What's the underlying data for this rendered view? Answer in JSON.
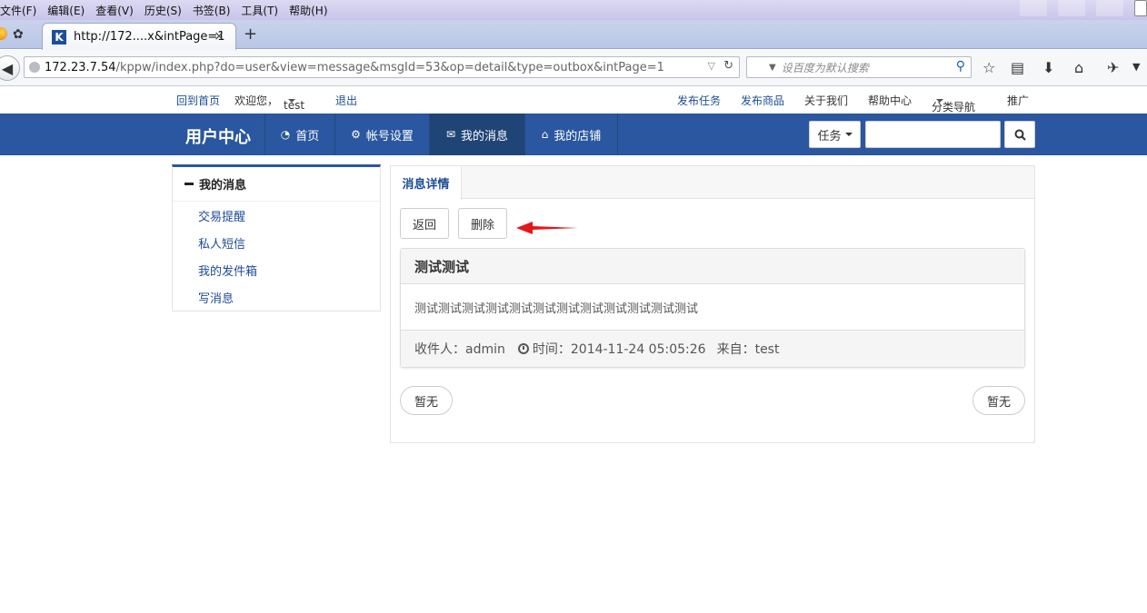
{
  "browser": {
    "menu": [
      "文件(F)",
      "编辑(E)",
      "查看(V)",
      "历史(S)",
      "书签(B)",
      "工具(T)",
      "帮助(H)"
    ],
    "tab_favicon": "K",
    "tab_title": "http://172....x&intPage=1",
    "tab_close": "×",
    "new_tab": "+",
    "url_host": "172.23.7.54",
    "url_path": "/kppw/index.php?do=user&view=message&msgId=53&op=detail&type=outbox&intPage=1",
    "search_placeholder": "设百度为默认搜索"
  },
  "site_top": {
    "home_link": "回到首页",
    "welcome": "欢迎您，",
    "username": "test",
    "logout": "退出",
    "right_links": [
      "发布任务",
      "发布商品",
      "关于我们",
      "帮助中心",
      "分类导航",
      "推广"
    ]
  },
  "header": {
    "brand": "用户中心",
    "nav": [
      "首页",
      "帐号设置",
      "我的消息",
      "我的店铺"
    ],
    "task_dropdown": "任务"
  },
  "sidebar": {
    "title": "我的消息",
    "items": [
      "交易提醒",
      "私人短信",
      "我的发件箱",
      "写消息"
    ]
  },
  "main": {
    "tab": "消息详情",
    "back_button": "返回",
    "delete_button": "删除",
    "message": {
      "title": "测试测试",
      "body": "测试测试测试测试测试测试测试测试测试测试测试测试",
      "recipient": "收件人：admin",
      "time": "时间：2014-11-24 05:05:26",
      "from": "来自：test"
    },
    "prev": "暂无",
    "next": "暂无"
  },
  "colors": {
    "header_blue": "#2a579f",
    "link_blue": "#1d4c94",
    "arrow_red": "#e8141b"
  }
}
